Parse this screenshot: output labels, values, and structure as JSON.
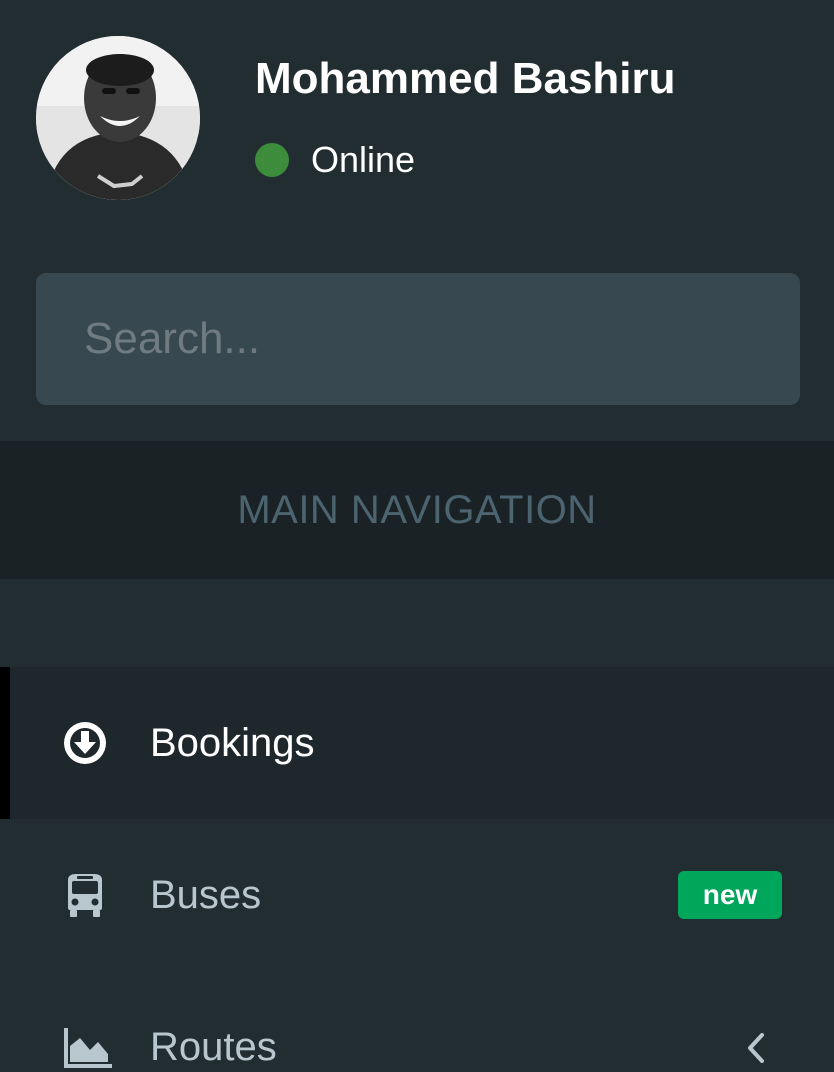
{
  "user": {
    "name": "Mohammed Bashiru",
    "status": "Online",
    "status_color": "#3c8c3c"
  },
  "search": {
    "placeholder": "Search..."
  },
  "nav": {
    "header": "MAIN NAVIGATION",
    "items": [
      {
        "label": "Bookings",
        "icon": "arrow-circle-down-icon",
        "active": true,
        "color": "#ffffff"
      },
      {
        "label": "Buses",
        "icon": "bus-icon",
        "active": false,
        "color": "#b8c7ce",
        "badge": "new",
        "badge_color": "#00a65a"
      },
      {
        "label": "Routes",
        "icon": "area-chart-icon",
        "active": false,
        "color": "#b8c7ce",
        "has_submenu": true
      }
    ]
  },
  "colors": {
    "sidebar_bg": "#222d32",
    "header_bg": "#1a2226",
    "header_text": "#4b646f",
    "search_bg": "#374850",
    "active_item_bg": "#1e282c"
  }
}
